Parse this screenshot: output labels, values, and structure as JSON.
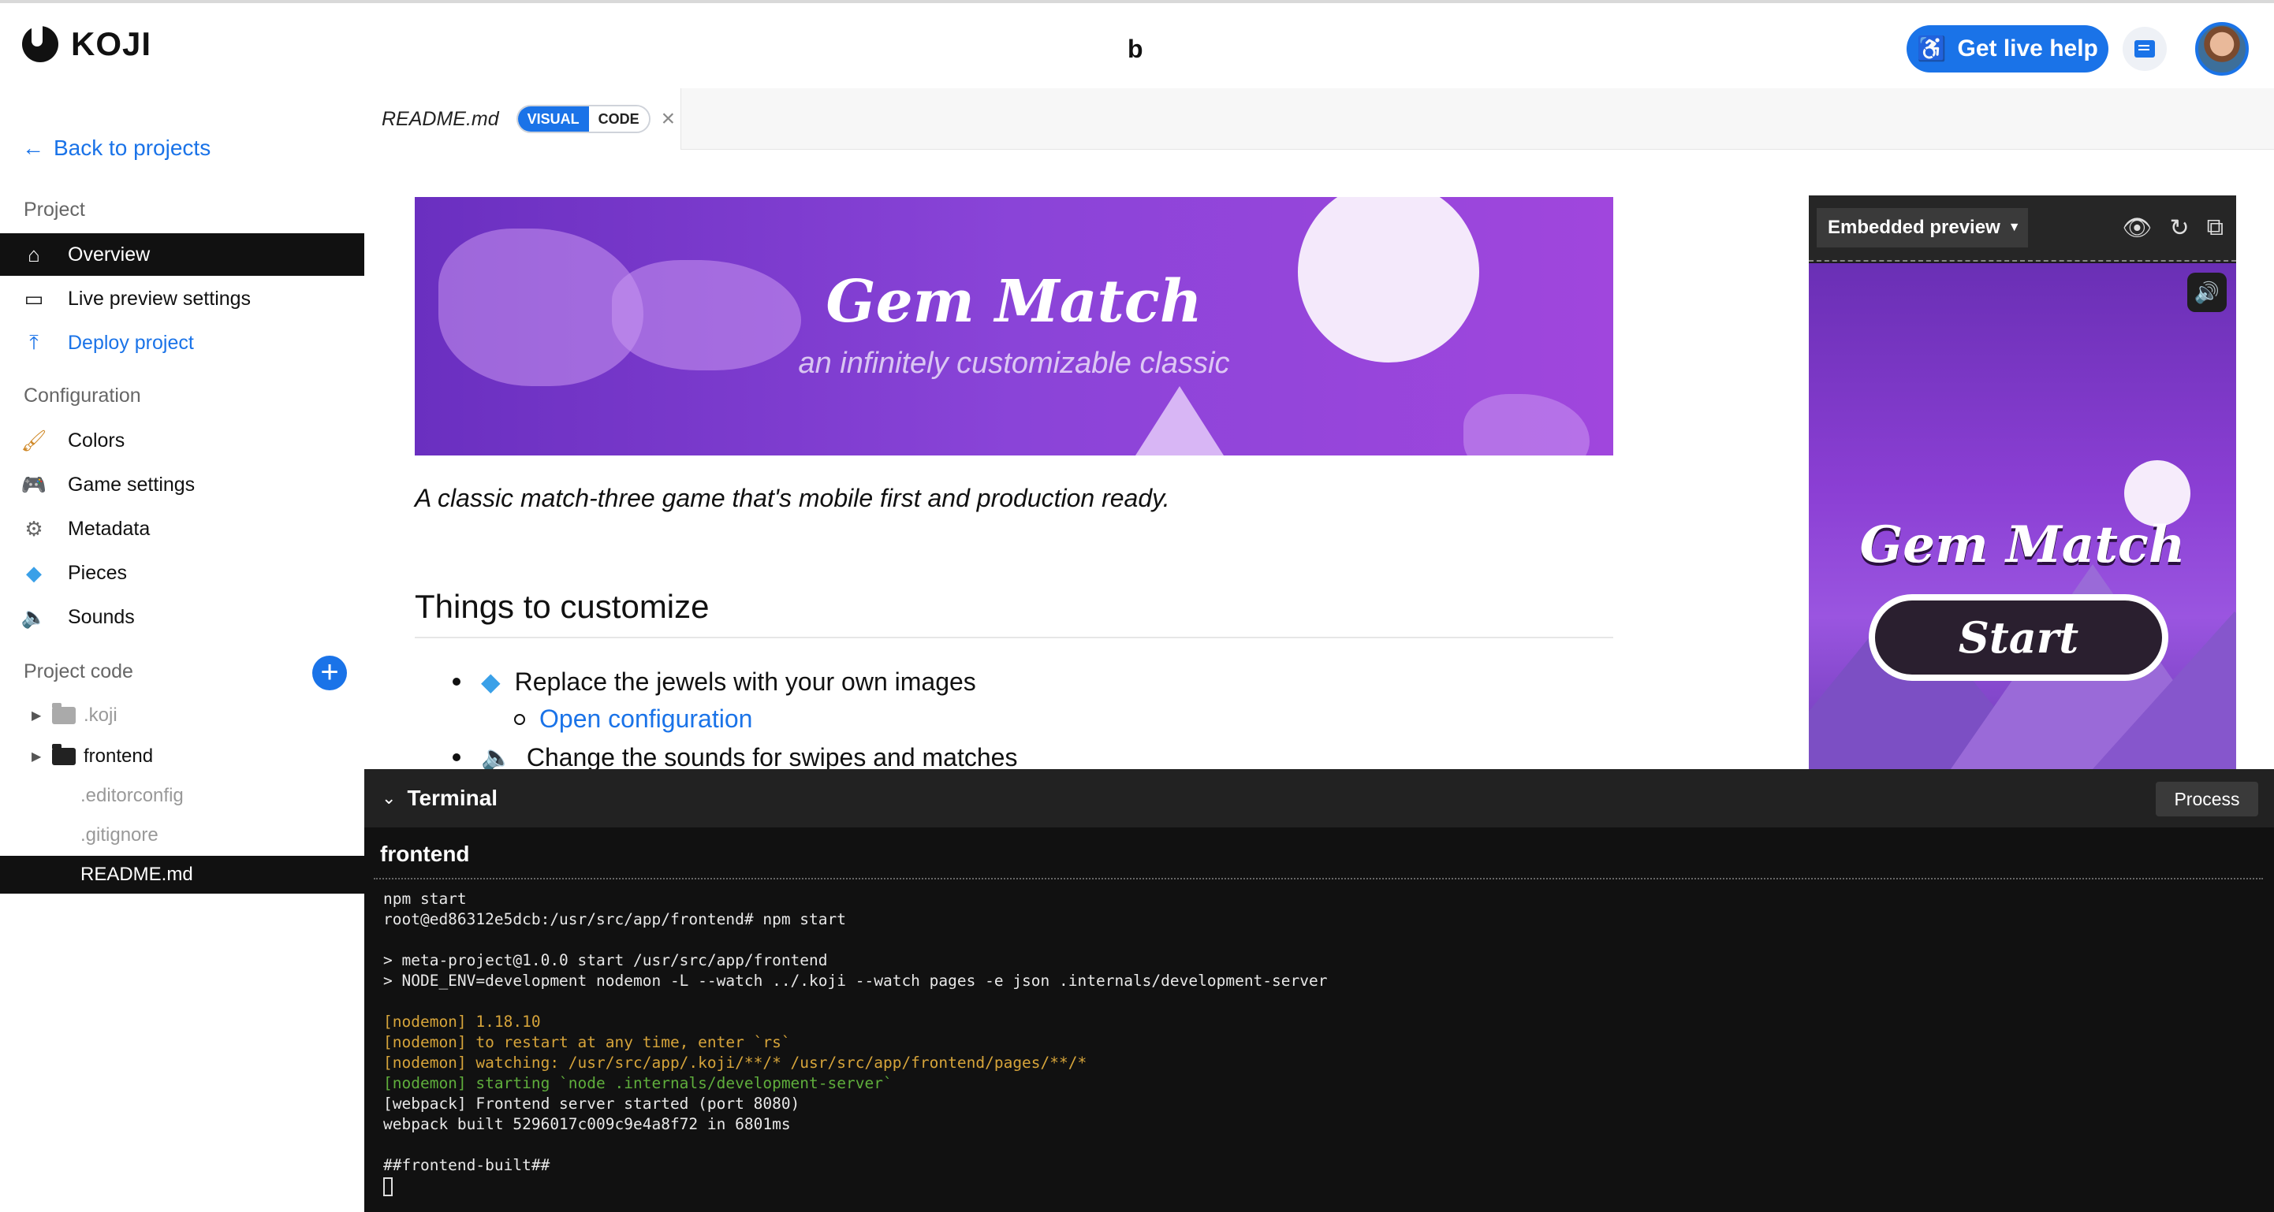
{
  "app": {
    "logo_text": "KOJI",
    "project_name": "b"
  },
  "header": {
    "help_label": "Get live help"
  },
  "sidebar": {
    "back_label": "Back to projects",
    "project_title": "Project",
    "project_items": [
      {
        "label": "Overview",
        "icon": "home-icon"
      },
      {
        "label": "Live preview settings",
        "icon": "devices-icon"
      },
      {
        "label": "Deploy project",
        "icon": "upload-icon"
      }
    ],
    "config_title": "Configuration",
    "config_items": [
      {
        "label": "Colors",
        "icon": "paint-brush-icon"
      },
      {
        "label": "Game settings",
        "icon": "gamepad-icon"
      },
      {
        "label": "Metadata",
        "icon": "gear-icon"
      },
      {
        "label": "Pieces",
        "icon": "gem-icon"
      },
      {
        "label": "Sounds",
        "icon": "speaker-icon"
      }
    ],
    "code_title": "Project code",
    "tree": [
      {
        "label": ".koji",
        "type": "folder"
      },
      {
        "label": "frontend",
        "type": "folder"
      },
      {
        "label": ".editorconfig",
        "type": "file"
      },
      {
        "label": ".gitignore",
        "type": "file"
      },
      {
        "label": "README.md",
        "type": "file"
      }
    ]
  },
  "editor": {
    "tab_name": "README.md",
    "mode_visual": "VISUAL",
    "mode_code": "CODE"
  },
  "doc": {
    "banner_title": "Gem Match",
    "banner_subtitle": "an infinitely customizable classic",
    "tagline": "A classic match-three game that's mobile first and production ready.",
    "heading": "Things to customize",
    "item1": "Replace the jewels with your own images",
    "item1_link": "Open configuration",
    "item2": "Change the sounds for swipes and matches"
  },
  "preview": {
    "mode_label": "Embedded preview",
    "game_title": "Gem Match",
    "start_label": "Start"
  },
  "terminal": {
    "title": "Terminal",
    "process_label": "Process",
    "session": "frontend",
    "lines": [
      {
        "text": "npm start",
        "color": "#e8e8e8"
      },
      {
        "text": "root@ed86312e5dcb:/usr/src/app/frontend# npm start",
        "color": "#e8e8e8"
      },
      {
        "text": "",
        "color": "#e8e8e8"
      },
      {
        "text": "> meta-project@1.0.0 start /usr/src/app/frontend",
        "color": "#e8e8e8"
      },
      {
        "text": "> NODE_ENV=development nodemon -L --watch ../.koji --watch pages -e json .internals/development-server",
        "color": "#e8e8e8"
      },
      {
        "text": "",
        "color": "#e8e8e8"
      },
      {
        "text": "[nodemon] 1.18.10",
        "color": "#d6a43a"
      },
      {
        "text": "[nodemon] to restart at any time, enter `rs`",
        "color": "#d6a43a"
      },
      {
        "text": "[nodemon] watching: /usr/src/app/.koji/**/* /usr/src/app/frontend/pages/**/*",
        "color": "#d6a43a"
      },
      {
        "text": "[nodemon] starting `node .internals/development-server`",
        "color": "#5fae3c"
      },
      {
        "text": "[webpack] Frontend server started (port 8080)",
        "color": "#e8e8e8"
      },
      {
        "text": "webpack built 5296017c009c9e4a8f72 in 6801ms",
        "color": "#e8e8e8"
      },
      {
        "text": "",
        "color": "#e8e8e8"
      },
      {
        "text": "##frontend-built##",
        "color": "#e8e8e8"
      }
    ]
  },
  "colors": {
    "accent": "#1a73e8",
    "dark": "#111111"
  }
}
